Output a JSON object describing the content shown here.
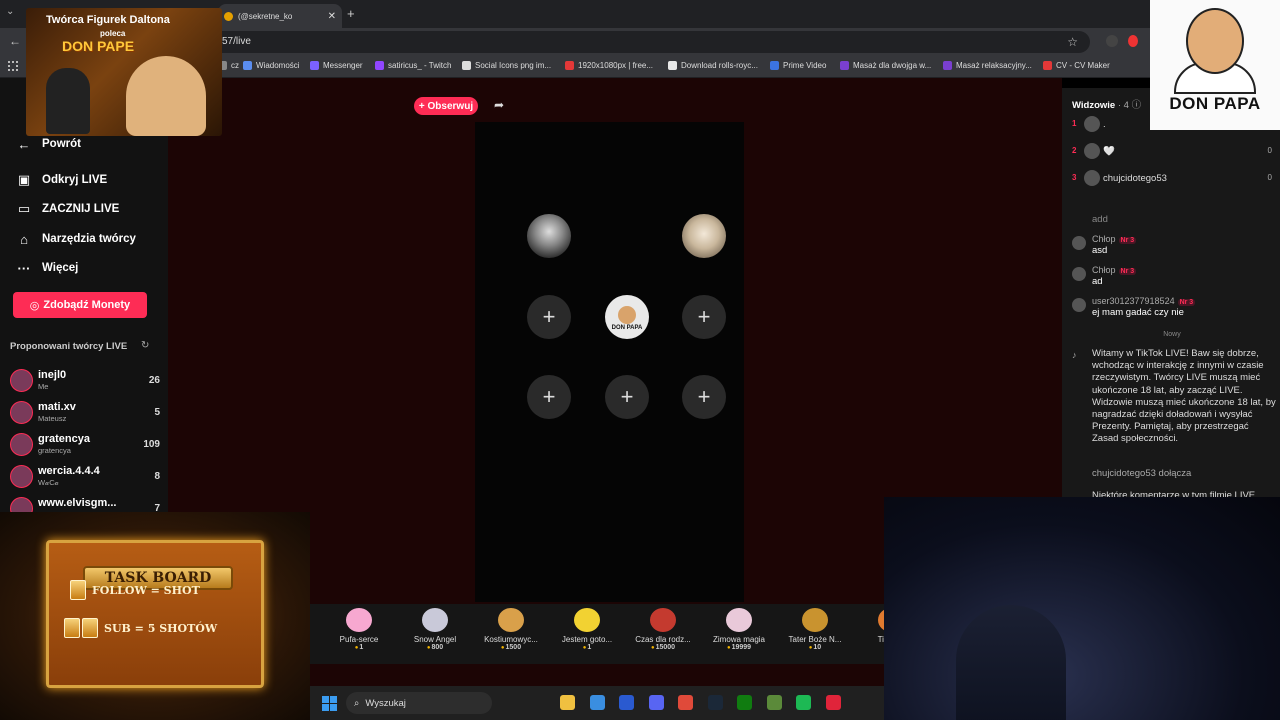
{
  "browser": {
    "tab_title": "(@sekretne_ko",
    "address": "57/live",
    "bookmarks": [
      {
        "label": "cz",
        "color": "#888888"
      },
      {
        "label": "Wiadomości",
        "color": "#5b8ef0"
      },
      {
        "label": "Messenger",
        "color": "#7b61ff"
      },
      {
        "label": "satiricus_ - Twitch",
        "color": "#9146ff"
      },
      {
        "label": "Social Icons png im...",
        "color": "#dddddd"
      },
      {
        "label": "1920x1080px | free...",
        "color": "#e33838"
      },
      {
        "label": "Download rolls-royc...",
        "color": "#e8e8e8"
      },
      {
        "label": "Prime Video",
        "color": "#3b73e0"
      },
      {
        "label": "Masaż dla dwojga w...",
        "color": "#7a3fd0"
      },
      {
        "label": "Masaż relaksacyjny...",
        "color": "#7a3fd0"
      },
      {
        "label": "CV - CV Maker",
        "color": "#e33838"
      }
    ]
  },
  "sidebar": {
    "back_label": "Powrót",
    "nav": [
      {
        "label": "Odkryj LIVE",
        "icon": "live-icon"
      },
      {
        "label": "ZACZNIJ LIVE",
        "icon": "camera-icon"
      },
      {
        "label": "Narzędzia twórcy",
        "icon": "tools-icon"
      },
      {
        "label": "Więcej",
        "icon": "more-icon"
      }
    ],
    "coins_label": "Zdobądź Monety",
    "suggested_title": "Proponowani twórcy LIVE",
    "creators": [
      {
        "name": "inejl0",
        "sub": "Me",
        "count": "26"
      },
      {
        "name": "mati.xv",
        "sub": "Mateusz",
        "count": "5"
      },
      {
        "name": "gratencya",
        "sub": "gratencya",
        "count": "109"
      },
      {
        "name": "wercia.4.4.4",
        "sub": "W𝒶C𝒶",
        "count": "8"
      },
      {
        "name": "www.elvisgm...",
        "sub": "",
        "count": "7"
      }
    ]
  },
  "stream": {
    "follow_label": "+ Obserwuj",
    "seats": [
      "+",
      "+",
      "+",
      "+",
      "+",
      "+"
    ],
    "host_label": "DON PAPA"
  },
  "gifts": [
    {
      "name": "Pufa-serce",
      "price": "1",
      "color": "#f7a8d0"
    },
    {
      "name": "Snow Angel",
      "price": "800",
      "color": "#c9c9d9"
    },
    {
      "name": "Kostiumowyc...",
      "price": "1500",
      "color": "#d9a04a"
    },
    {
      "name": "Jestem goto...",
      "price": "1",
      "color": "#f2d232"
    },
    {
      "name": "Czas dla rodz...",
      "price": "15000",
      "color": "#c43a2f"
    },
    {
      "name": "Zimowa magia",
      "price": "19999",
      "color": "#e9c9d9"
    },
    {
      "name": "Tater Boże N...",
      "price": "10",
      "color": "#c9932f"
    },
    {
      "name": "Tiny Bo",
      "price": "",
      "color": "#e07a2f"
    }
  ],
  "chat": {
    "viewers_label": "Widzowie",
    "viewers_count": "· 4",
    "viewers": [
      {
        "rank": "1",
        "name": ".",
        "score": ""
      },
      {
        "rank": "2",
        "name": "🤍",
        "score": "0"
      },
      {
        "rank": "3",
        "name": "chujcidotego53",
        "score": "0"
      }
    ],
    "messages": [
      {
        "user": "",
        "badge": "",
        "text": "add"
      },
      {
        "user": "Chłop",
        "badge": "Nr 3",
        "text": "asd"
      },
      {
        "user": "Chłop",
        "badge": "Nr 3",
        "text": "ad"
      },
      {
        "user": "user3012377918524",
        "badge": "Nr 3",
        "text": "ej mam gadać czy nie"
      }
    ],
    "new_divider": "Nowy",
    "welcome": "Witamy w TikTok LIVE! Baw się dobrze, wchodząc w interakcję z innymi w czasie rzeczywistym. Twórcy LIVE muszą mieć ukończone 18 lat, aby zacząć LIVE. Widzowie muszą mieć ukończone 18 lat, by nagradzać dzięki doładowań i wysyłać Prezenty. Pamiętaj, aby przestrzegać Zasad społeczności.",
    "bottom_user": "chujcidotego53 dołącza",
    "bottom_note": "Niektóre komentarze w tym filmie LIVE"
  },
  "overlays": {
    "promo_line1": "Twórca Figurek Daltona",
    "promo_line2": "poleca",
    "promo_line3": "DON PAPE",
    "logo_text": "DON PAPA",
    "taskboard_title": "TASK BOARD",
    "taskboard_rows": [
      "FOLLOW = SHOT",
      "SUB = 5 SHOTÓW"
    ]
  },
  "taskbar": {
    "search_placeholder": "Wyszukaj",
    "apps": [
      {
        "name": "file-explorer",
        "color": "#f0c040"
      },
      {
        "name": "store",
        "color": "#3a8ee0"
      },
      {
        "name": "l-app",
        "color": "#2a5ad0"
      },
      {
        "name": "discord",
        "color": "#5865f2"
      },
      {
        "name": "chrome",
        "color": "#e04a3a"
      },
      {
        "name": "steam",
        "color": "#1b2838"
      },
      {
        "name": "xbox",
        "color": "#107c10"
      },
      {
        "name": "minecraft",
        "color": "#5b8a3a"
      },
      {
        "name": "spotify",
        "color": "#1db954"
      },
      {
        "name": "opera",
        "color": "#e0243a"
      }
    ]
  }
}
